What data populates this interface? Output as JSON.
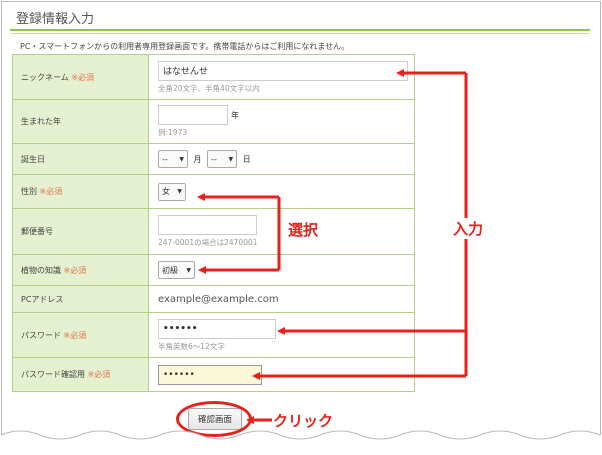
{
  "page": {
    "title": "登録情報入力",
    "notice": "PC・スマートフォンからの利用者専用登録画面です。携帯電話からはご利用になれません。"
  },
  "required_mark": "※必須",
  "form": {
    "nickname": {
      "label": "ニックネーム",
      "value": "はなせんせ",
      "hint": "全角20文字、半角40文字以内"
    },
    "birth_year": {
      "label": "生まれた年",
      "value": "",
      "unit": "年",
      "hint": "例:1973"
    },
    "birthday": {
      "label": "誕生日",
      "month_value": "--",
      "month_unit": "月",
      "day_value": "--",
      "day_unit": "日"
    },
    "gender": {
      "label": "性別",
      "value": "女"
    },
    "postal_code": {
      "label": "郵便番号",
      "value": "",
      "hint": "247-0001の場合は2470001"
    },
    "plant_knowledge": {
      "label": "植物の知識",
      "value": "初級"
    },
    "pc_address": {
      "label": "PCアドレス",
      "value": "example@example.com"
    },
    "password": {
      "label": "パスワード",
      "value": "••••••",
      "hint": "半角英数6～12文字"
    },
    "password_confirm": {
      "label": "パスワード確認用",
      "value": "••••••"
    }
  },
  "confirm_button": "確認画面",
  "annotations": {
    "input": "入力",
    "select": "選択",
    "click": "クリック"
  },
  "colors": {
    "accent_green": "#8fc34a",
    "label_bg": "#e4f0cf",
    "required": "#e0754f",
    "annotation_red": "#e8211a"
  }
}
